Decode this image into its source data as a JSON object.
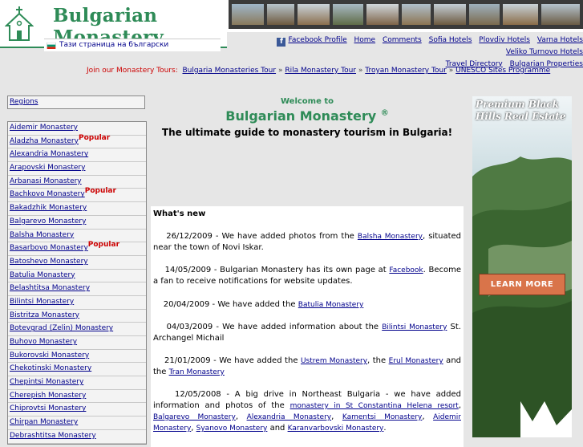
{
  "header": {
    "site_title": "Bulgarian Monastery",
    "bulgarian_link": "Тази страница на български"
  },
  "topnav": {
    "items": [
      "Facebook Profile",
      "Home",
      "Comments",
      "Sofia Hotels",
      "Plovdiv Hotels",
      "Varna Hotels",
      "Veliko Turnovo Hotels",
      "Travel Directory",
      "Bulgarian Properties"
    ]
  },
  "tours": {
    "label": "Join our Monastery Tours:",
    "links": [
      "Bulgaria Monasteries Tour",
      "Rila Monastery Tour",
      "Troyan Monastery Tour",
      "UNESCO Sites Programme"
    ],
    "separator": "»"
  },
  "sidebar": {
    "regions_label": "Regions",
    "popular_label": "Popular",
    "monasteries": [
      {
        "name": "Aidemir Monastery",
        "popular": false
      },
      {
        "name": "Aladzha Monastery",
        "popular": true
      },
      {
        "name": "Alexandria Monastery",
        "popular": false
      },
      {
        "name": "Arapovski Monastery",
        "popular": false
      },
      {
        "name": "Arbanasi Monastery",
        "popular": false
      },
      {
        "name": "Bachkovo Monastery",
        "popular": true
      },
      {
        "name": "Bakadzhik Monastery",
        "popular": false
      },
      {
        "name": "Balgarevo Monastery",
        "popular": false
      },
      {
        "name": "Balsha Monastery",
        "popular": false
      },
      {
        "name": "Basarbovo Monastery",
        "popular": true
      },
      {
        "name": "Batoshevo Monastery",
        "popular": false
      },
      {
        "name": "Batulia Monastery",
        "popular": false
      },
      {
        "name": "Belashtitsa Monastery",
        "popular": false
      },
      {
        "name": "Bilintsi Monastery",
        "popular": false
      },
      {
        "name": "Bistritza Monastery",
        "popular": false
      },
      {
        "name": "Botevgrad (Zelin) Monastery",
        "popular": false
      },
      {
        "name": "Buhovo Monastery",
        "popular": false
      },
      {
        "name": "Bukorovski Monastery",
        "popular": false
      },
      {
        "name": "Chekotinski Monastery",
        "popular": false
      },
      {
        "name": "Chepintsi Monastery",
        "popular": false
      },
      {
        "name": "Cherepish Monastery",
        "popular": false
      },
      {
        "name": "Chiprovtsi Monastery",
        "popular": false
      },
      {
        "name": "Chirpan Monastery",
        "popular": false
      },
      {
        "name": "Debrashtitsa Monastery",
        "popular": false
      }
    ]
  },
  "main": {
    "welcome": "Welcome to",
    "title": "Bulgarian Monastery",
    "title_mark": "®",
    "tagline": "The ultimate guide to monastery tourism in Bulgaria!",
    "news_heading": "What's new",
    "news": [
      {
        "date": "26/12/2009",
        "before": " - We have added photos from the ",
        "link": "Balsha Monastery",
        "after": ", situated near the town of Novi Iskar."
      },
      {
        "date": "14/05/2009",
        "before": " - Bulgarian Monastery has its own page at ",
        "link": "Facebook",
        "after": ". Become a fan to receive notifications for website updates."
      },
      {
        "date": "20/04/2009",
        "before": " - We have added the ",
        "link": "Batulia Monastery",
        "after": ""
      },
      {
        "date": "04/03/2009",
        "before": " - We have added information about the ",
        "link": "Bilintsi Monastery",
        "after": " St. Archangel Michail"
      },
      {
        "date": "21/01/2009",
        "before": " - We have added the ",
        "link": "Ustrem Monastery",
        "mid1": ", the ",
        "link2": "Erul Monastery",
        "mid2": " and the ",
        "link3": "Tran Monastery",
        "after": ""
      },
      {
        "date": "12/05/2008",
        "text": " - A big drive in Northeast Bulgaria - we have added information and photos of the ",
        "links": [
          "monastery in St Constantina Helena resort",
          "Balgarevo Monastery",
          "Alexandria Monastery",
          "Kamentsi Monastery",
          "Aidemir Monastery",
          "Syanovo Monastery",
          "Karanvarbovski Monastery"
        ],
        "and_word": "and"
      }
    ]
  },
  "ad": {
    "headline": "Premium Black Hills Real Estate",
    "button": "LEARN MORE"
  },
  "colors": {
    "brand_green": "#2e8b57",
    "link": "#00008b",
    "popular_red": "#cc0000",
    "background": "#e6e6e6"
  }
}
